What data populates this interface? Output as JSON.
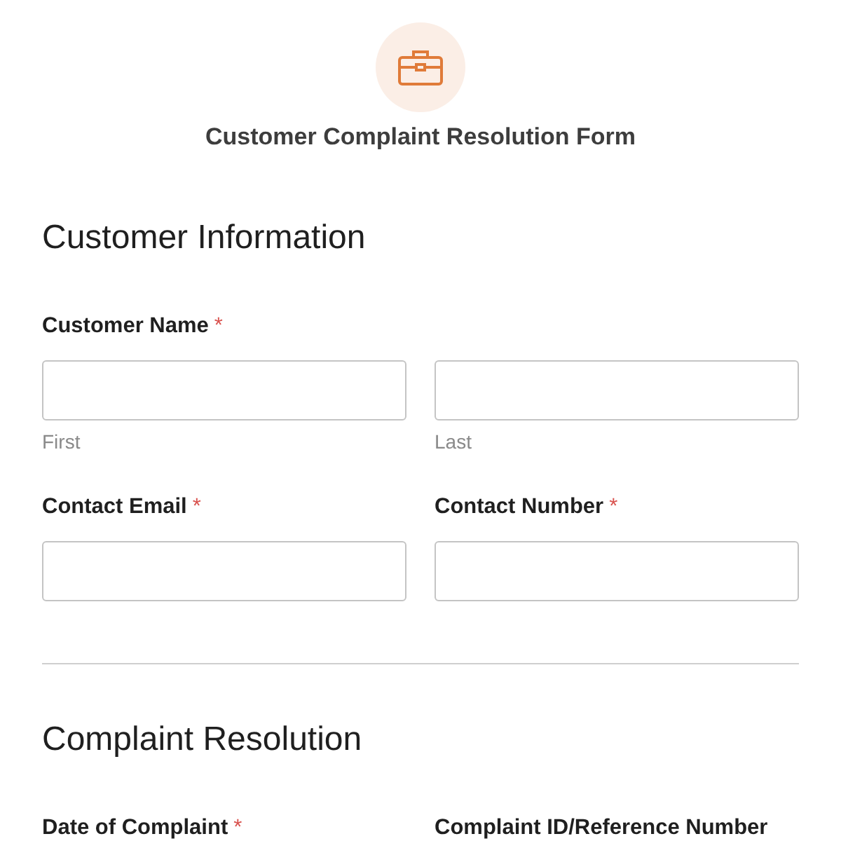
{
  "form": {
    "title": "Customer Complaint Resolution Form"
  },
  "sections": [
    {
      "title": "Customer Information",
      "fields": [
        {
          "kind": "name",
          "label": "Customer Name",
          "required_mark": "*",
          "inputs": [
            {
              "sublabel": "First"
            },
            {
              "sublabel": "Last"
            }
          ]
        },
        {
          "kind": "text",
          "label": "Contact Email",
          "required_mark": "*"
        },
        {
          "kind": "text",
          "label": "Contact Number",
          "required_mark": "*"
        }
      ]
    },
    {
      "title": "Complaint Resolution",
      "fields": [
        {
          "kind": "label-only",
          "label": "Date of Complaint",
          "required_mark": "*"
        },
        {
          "kind": "label-only",
          "label": "Complaint ID/Reference Number"
        }
      ]
    }
  ]
}
